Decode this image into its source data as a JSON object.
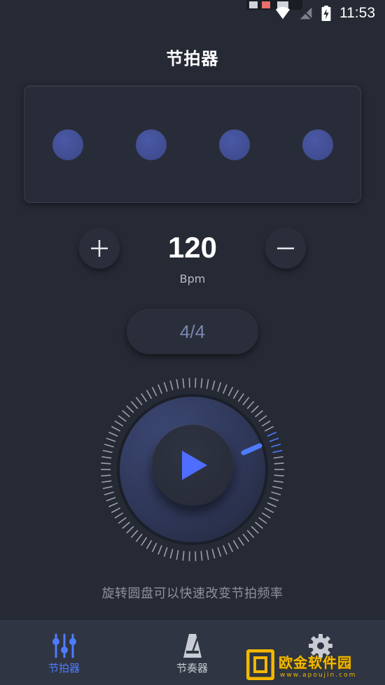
{
  "status_bar": {
    "time": "11:53"
  },
  "header": {
    "title": "节拍器"
  },
  "beat_panel": {
    "beats": 4
  },
  "tempo": {
    "value": "120",
    "unit": "Bpm"
  },
  "time_signature": {
    "label": "4/4"
  },
  "dial": {
    "hint": "旋转圆盘可以快速改变节拍频率"
  },
  "bottom_nav": {
    "items": [
      {
        "label": "节拍器",
        "icon": "sliders-icon",
        "active": true
      },
      {
        "label": "节奏器",
        "icon": "metronome-icon",
        "active": false
      },
      {
        "label": "",
        "icon": "gear-icon",
        "active": false
      }
    ]
  },
  "watermark": {
    "text": "欧金软件园",
    "sub": "www.apoujin.com"
  },
  "colors": {
    "background": "#262a35",
    "accent": "#4f7bff",
    "dot": "#4352a0",
    "nav_bg": "#2f3542"
  }
}
